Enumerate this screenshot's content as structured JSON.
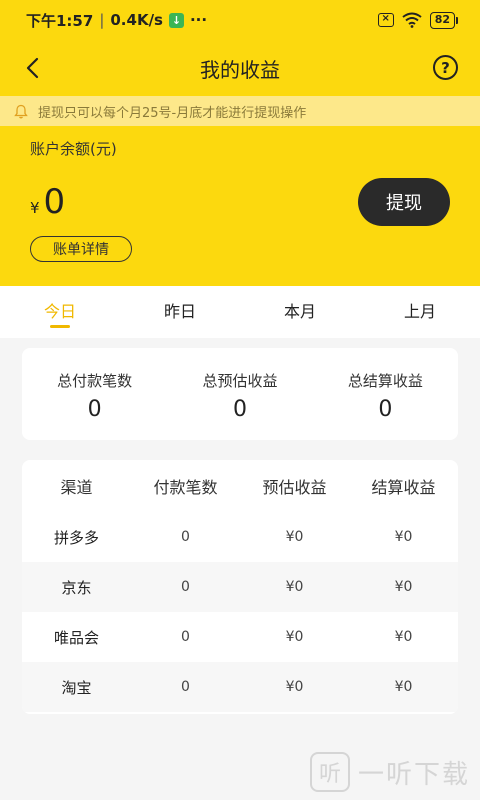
{
  "status_bar": {
    "time": "下午1:57",
    "speed": "0.4K/s",
    "download_glyph": "↓",
    "more": "···",
    "sim": "×",
    "battery": "82"
  },
  "nav": {
    "title": "我的收益",
    "help": "?"
  },
  "notice": {
    "text": "提现只可以每个月25号-月底才能进行提现操作"
  },
  "balance": {
    "label": "账户余额(元)",
    "currency": "¥",
    "amount": "0",
    "withdraw_label": "提现",
    "bill_label": "账单详情"
  },
  "tabs": [
    {
      "label": "今日",
      "active": true
    },
    {
      "label": "昨日",
      "active": false
    },
    {
      "label": "本月",
      "active": false
    },
    {
      "label": "上月",
      "active": false
    }
  ],
  "summary": [
    {
      "label": "总付款笔数",
      "value": "0"
    },
    {
      "label": "总预估收益",
      "value": "0"
    },
    {
      "label": "总结算收益",
      "value": "0"
    }
  ],
  "channel_table": {
    "headers": [
      "渠道",
      "付款笔数",
      "预估收益",
      "结算收益"
    ],
    "rows": [
      [
        "拼多多",
        "0",
        "¥0",
        "¥0"
      ],
      [
        "京东",
        "0",
        "¥0",
        "¥0"
      ],
      [
        "唯品会",
        "0",
        "¥0",
        "¥0"
      ],
      [
        "淘宝",
        "0",
        "¥0",
        "¥0"
      ]
    ]
  },
  "watermark": {
    "logo": "听",
    "text": "一听下载"
  },
  "colors": {
    "brand_yellow": "#fcd90e",
    "notice_bg": "#fde88a",
    "active_tab": "#f0b800",
    "button_dark": "#2a2a2a"
  }
}
